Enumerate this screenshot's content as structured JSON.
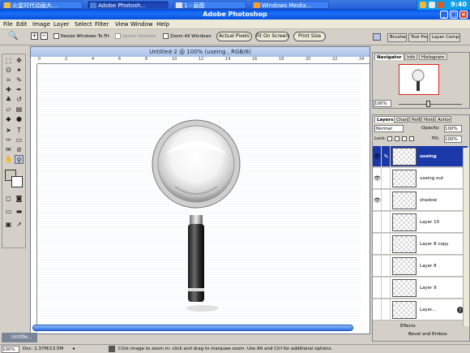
{
  "taskbar": {
    "buttons": [
      "火星时代动画大...",
      "Adobe Photosh...",
      "1 - 画图",
      "Windows Media..."
    ],
    "clock": "9:40"
  },
  "window": {
    "title": "Adobe Photoshop"
  },
  "menu": [
    "File",
    "Edit",
    "Image",
    "Layer",
    "Select",
    "Filter",
    "View",
    "Window",
    "Help"
  ],
  "options": {
    "resize_windows": "Resize Windows To Fit",
    "ignore_palettes": "Ignore Palettes",
    "zoom_all": "Zoom All Windows",
    "actual_pixels": "Actual Pixels",
    "fit_on_screen": "Fit On Screen",
    "print_size": "Print Size",
    "palette_tabs": [
      "Brushes",
      "Tool Presets",
      "Layer Comps"
    ]
  },
  "document": {
    "title": "Untitled-2 @ 100% (useing , RGB/8)",
    "ruler_numbers": [
      "0",
      "2",
      "4",
      "6",
      "8",
      "10",
      "12",
      "14",
      "16",
      "18",
      "20",
      "22",
      "24"
    ],
    "minimized_label": "Untitle..."
  },
  "navigator": {
    "tabs": [
      "Navigator",
      "Info",
      "Histogram"
    ],
    "zoom": "100%"
  },
  "layers": {
    "tabs": [
      "Layers",
      "Channels",
      "Paths",
      "History",
      "Actions"
    ],
    "blend_mode": "Normal",
    "opacity_label": "Opacity:",
    "opacity_value": "100%",
    "lock_label": "Lock:",
    "fill_label": "Fill:",
    "fill_value": "100%",
    "rows": [
      {
        "name": "useing",
        "visible": true,
        "selected": true
      },
      {
        "name": "useing out",
        "visible": true,
        "selected": false
      },
      {
        "name": "shadow",
        "visible": true,
        "selected": false
      },
      {
        "name": "Layer 10",
        "visible": false,
        "selected": false
      },
      {
        "name": "Layer 8 copy",
        "visible": false,
        "selected": false
      },
      {
        "name": "Layer 8",
        "visible": false,
        "selected": false
      },
      {
        "name": "Layer 9",
        "visible": false,
        "selected": false
      },
      {
        "name": "Layer...",
        "visible": false,
        "selected": false
      }
    ],
    "effects_label": "Effects",
    "bevel_label": "Bevel and Embos"
  },
  "status": {
    "zoom": "100%",
    "doc": "Doc: 1.37M/13.5M",
    "hint": "Click image to zoom in; click and drag to marquee zoom.  Use Alt and Ctrl for additional options."
  },
  "colors": {
    "title_bar": "#0058ee",
    "taskbar": "#245edb",
    "selection": "#1b38a8"
  }
}
